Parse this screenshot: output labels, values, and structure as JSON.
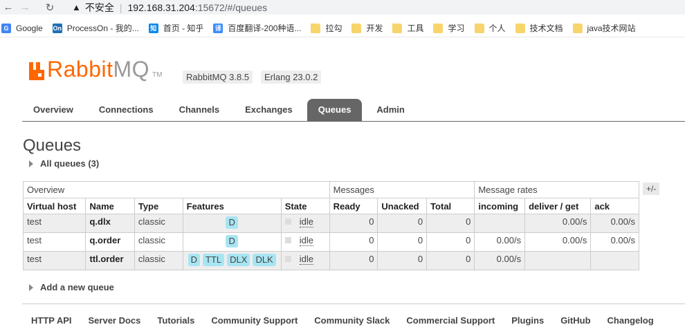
{
  "browser": {
    "insecure_label": "不安全",
    "url_host": "192.168.31.204",
    "url_rest": ":15672/#/queues",
    "bookmarks": [
      {
        "label": "Google",
        "icon": "google-icon",
        "color": "#4285f4",
        "glyph": "G"
      },
      {
        "label": "ProcessOn - 我的...",
        "icon": "processon-icon",
        "color": "#1f6fb5",
        "glyph": "On"
      },
      {
        "label": "首页 - 知乎",
        "icon": "zhihu-icon",
        "color": "#0f88eb",
        "glyph": "知"
      },
      {
        "label": "百度翻译-200种语...",
        "icon": "baidu-translate-icon",
        "color": "#3b8cff",
        "glyph": "译"
      },
      {
        "label": "拉勾",
        "icon": "folder-icon"
      },
      {
        "label": "开发",
        "icon": "folder-icon"
      },
      {
        "label": "工具",
        "icon": "folder-icon"
      },
      {
        "label": "学习",
        "icon": "folder-icon"
      },
      {
        "label": "个人",
        "icon": "folder-icon"
      },
      {
        "label": "技术文档",
        "icon": "folder-icon"
      },
      {
        "label": "java技术网站",
        "icon": "folder-icon"
      }
    ]
  },
  "header": {
    "logo_rabbit": "Rabbit",
    "logo_mq": "MQ",
    "logo_tm": "TM",
    "version": "RabbitMQ 3.8.5",
    "erlang": "Erlang 23.0.2",
    "brand_color": "#ff6600"
  },
  "nav": {
    "tabs": [
      "Overview",
      "Connections",
      "Channels",
      "Exchanges",
      "Queues",
      "Admin"
    ],
    "active": "Queues"
  },
  "page": {
    "title": "Queues",
    "all_queues": "All queues (3)",
    "add_queue": "Add a new queue",
    "plus_minus": "+/-"
  },
  "table": {
    "groups": [
      "Overview",
      "Messages",
      "Message rates"
    ],
    "columns": [
      "Virtual host",
      "Name",
      "Type",
      "Features",
      "State",
      "Ready",
      "Unacked",
      "Total",
      "incoming",
      "deliver / get",
      "ack"
    ],
    "rows": [
      {
        "vhost": "test",
        "name": "q.dlx",
        "type": "classic",
        "features": [
          "D"
        ],
        "state": "idle",
        "ready": "0",
        "unacked": "0",
        "total": "0",
        "incoming": "",
        "deliver_get": "0.00/s",
        "ack": "0.00/s"
      },
      {
        "vhost": "test",
        "name": "q.order",
        "type": "classic",
        "features": [
          "D"
        ],
        "state": "idle",
        "ready": "0",
        "unacked": "0",
        "total": "0",
        "incoming": "0.00/s",
        "deliver_get": "0.00/s",
        "ack": "0.00/s"
      },
      {
        "vhost": "test",
        "name": "ttl.order",
        "type": "classic",
        "features": [
          "D",
          "TTL",
          "DLX",
          "DLK"
        ],
        "state": "idle",
        "ready": "0",
        "unacked": "0",
        "total": "0",
        "incoming": "0.00/s",
        "deliver_get": "",
        "ack": ""
      }
    ]
  },
  "footer": {
    "links": [
      "HTTP API",
      "Server Docs",
      "Tutorials",
      "Community Support",
      "Community Slack",
      "Commercial Support",
      "Plugins",
      "GitHub",
      "Changelog"
    ]
  }
}
